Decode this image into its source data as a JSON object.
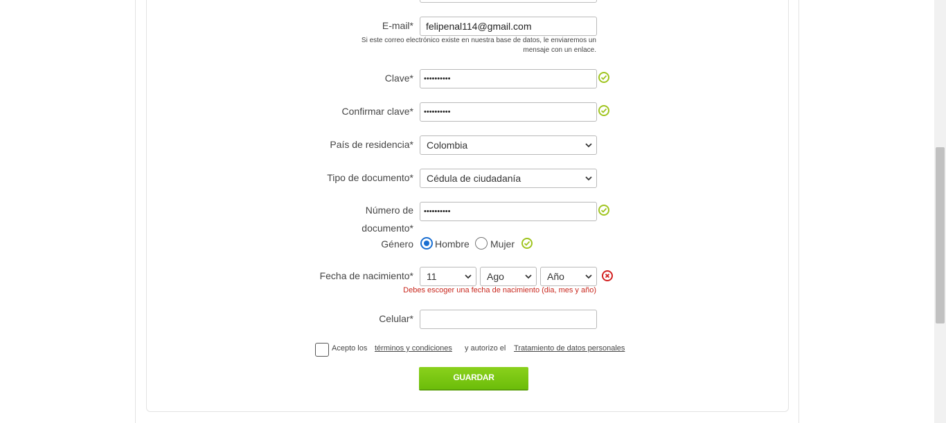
{
  "form": {
    "email": {
      "label": "E-mail*",
      "value": "felipenal114@gmail.com",
      "help_line1": "Si este correo electrónico existe en nuestra base de datos, le enviaremos un",
      "help_line2": "mensaje con un enlace."
    },
    "password": {
      "label": "Clave*",
      "value": "••••••••••"
    },
    "confirm_password": {
      "label": "Confirmar clave*",
      "value": "••••••••••"
    },
    "country": {
      "label": "País de residencia*",
      "selected": "Colombia"
    },
    "document_type": {
      "label": "Tipo de documento*",
      "selected": "Cédula de ciudadanía"
    },
    "document_number": {
      "label_line1": "Número de",
      "label_line2": "documento*",
      "value": "••••••••••"
    },
    "gender": {
      "label": "Género",
      "options": [
        {
          "label": "Hombre",
          "checked": true
        },
        {
          "label": "Mujer",
          "checked": false
        }
      ]
    },
    "birth_date": {
      "label": "Fecha de nacimiento*",
      "day": "11",
      "month": "Ago",
      "year": "Año",
      "error": "Debes escoger una fecha de nacimiento (dia, mes y año)"
    },
    "mobile": {
      "label": "Celular*",
      "value": ""
    },
    "terms": {
      "prefix": "Acepto los",
      "terms_link": "términos y condiciones",
      "middle": "y autorizo el",
      "privacy_link": "Tratamiento de datos personales",
      "checked": false
    },
    "save_button": "GUARDAR"
  },
  "colors": {
    "valid": "#9fc41e",
    "error": "#d21f1f",
    "button": "#7ac511",
    "radio_accent": "#1a6fd1"
  },
  "icons": {
    "valid": "check-circle-icon",
    "invalid": "x-circle-icon",
    "select": "chevron-down-icon"
  }
}
